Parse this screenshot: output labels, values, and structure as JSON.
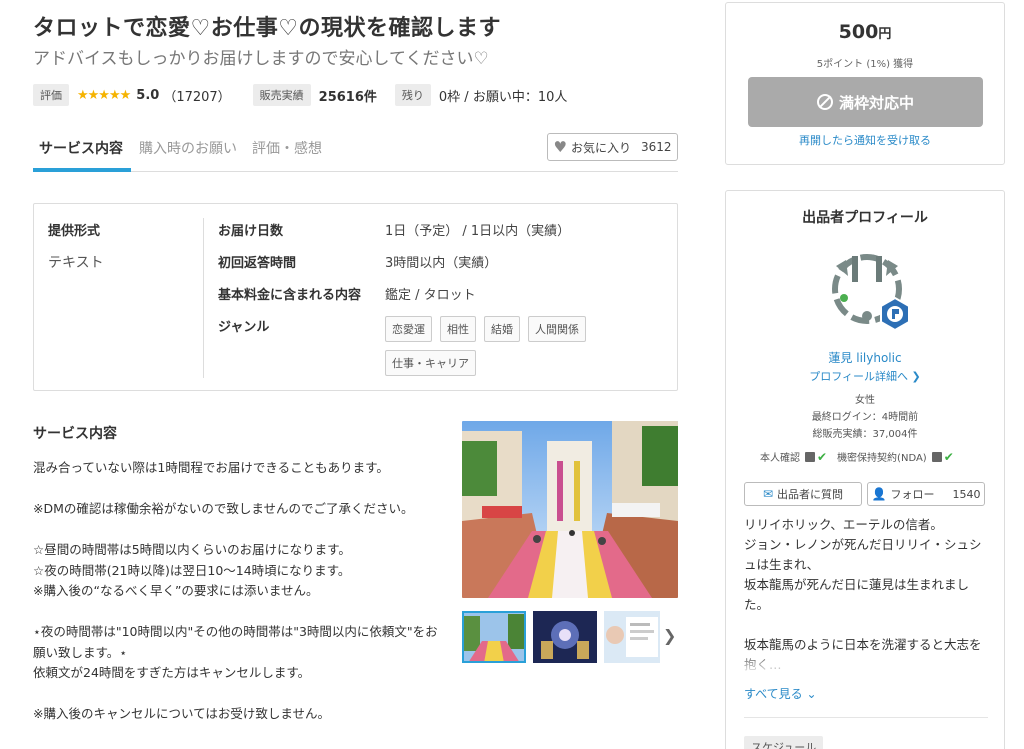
{
  "header": {
    "title": "タロットで恋愛♡お仕事♡の現状を確認します",
    "subtitle": "アドバイスもしっかりお届けしますので安心してください♡"
  },
  "stats": {
    "rating_label": "評価",
    "stars": "★★★★★",
    "rating": "5.0",
    "review_count": "（17207）",
    "sales_label": "販売実績",
    "sales": "25616件",
    "remaining_label": "残り",
    "remaining": "0枠 / お願い中：10人"
  },
  "tabs": [
    {
      "label": "サービス内容"
    },
    {
      "label": "購入時のお願い"
    },
    {
      "label": "評価・感想"
    }
  ],
  "favorite": {
    "label": "お気に入り",
    "count": "3612"
  },
  "info": {
    "format_label": "提供形式",
    "format_value": "テキスト",
    "rows": [
      {
        "label": "お届け日数",
        "value": "1日（予定） / 1日以内（実績）"
      },
      {
        "label": "初回返答時間",
        "value": "3時間以内（実績）"
      },
      {
        "label": "基本料金に含まれる内容",
        "value": "鑑定 / タロット"
      },
      {
        "label": "ジャンル",
        "value": ""
      }
    ],
    "genres": [
      "恋愛運",
      "相性",
      "結婚",
      "人間関係",
      "仕事・キャリア"
    ]
  },
  "description": {
    "heading": "サービス内容",
    "text": "混み合っていない際は1時間程でお届けできることもあります。\n\n※DMの確認は稼働余裕がないので致しませんのでご了承ください。\n\n☆昼間の時間帯は5時間以内くらいのお届けになります。\n☆夜の時間帯(21時以降)は翌日10〜14時頃になります。\n※購入後の“なるべく早く”の要求には添いません。\n\n⋆夜の時間帯は\"10時間以内\"その他の時間帯は\"3時間以内に依頼文\"をお願い致します。⋆\n依頼文が24時間をすぎた方はキャンセルします。\n\n※購入後のキャンセルについてはお受け致しません。"
  },
  "purchase": {
    "price": "500",
    "yen": "円",
    "points": "5ポイント (1%) 獲得",
    "button": "満枠対応中",
    "notify": "再開したら通知を受け取る"
  },
  "profile": {
    "title": "出品者プロフィール",
    "name": "蓮見 lilyholic",
    "detail_link": "プロフィール詳細へ ❯",
    "gender": "女性",
    "last_login": "最終ログイン：4時間前",
    "total_sales": "総販売実績：37,004件",
    "identity": "本人確認",
    "nda": "機密保持契約(NDA)",
    "message_button": "出品者に質問",
    "follow_button": "フォロー",
    "follow_count": "1540",
    "bio": "リリイホリック、エーテルの信者。\nジョン・レノンが死んだ日リリイ・シュシュは生まれ、\n坂本龍馬が死んだ日に蓮見は生まれました。\n\n坂本龍馬のように日本を洗濯すると大志を抱く…",
    "see_all": "すべて見る ⌄",
    "schedule": "スケジュール"
  },
  "colors": {
    "accent": "#2aa0d8",
    "link": "#2a8ac8",
    "star": "#f5b300",
    "disabled_button": "#aaaaaa"
  }
}
